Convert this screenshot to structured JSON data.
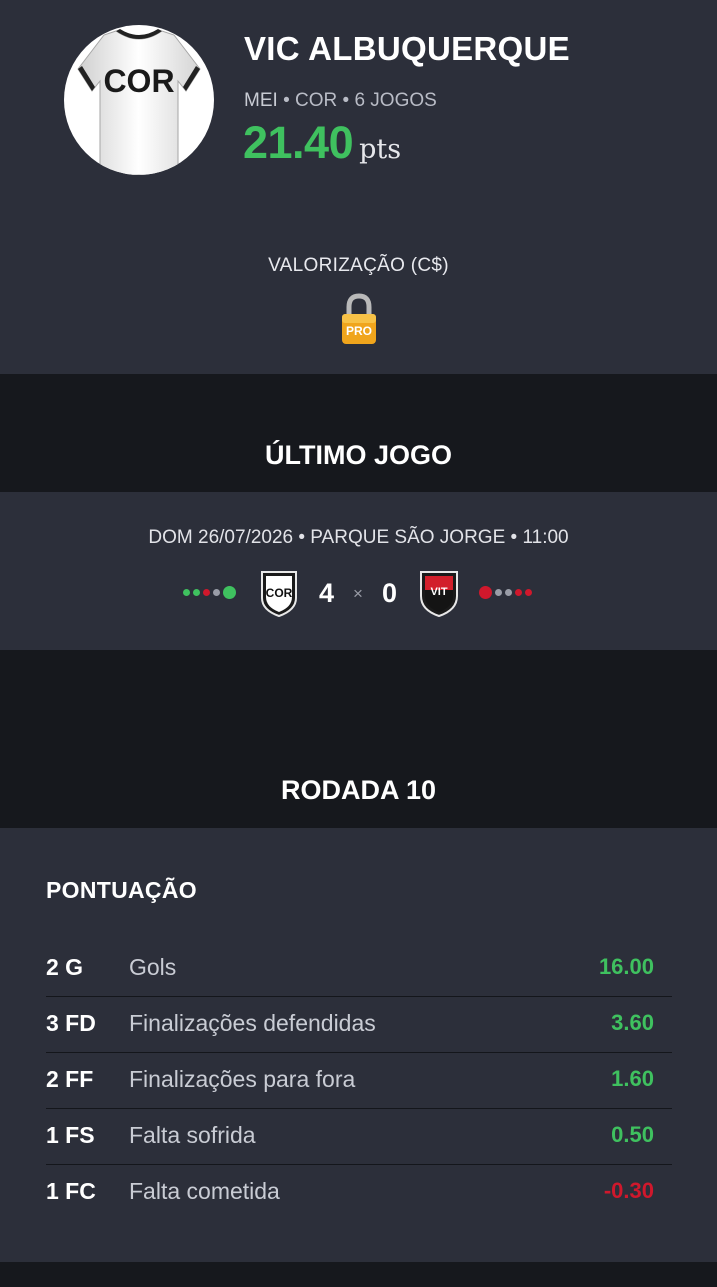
{
  "player": {
    "name": "VIC ALBUQUERQUE",
    "position": "MEI",
    "club": "COR",
    "games": "6 JOGOS",
    "separator": "•",
    "score": "21.40",
    "score_unit": "pts",
    "jersey_text": "COR"
  },
  "valorizacao": {
    "label": "VALORIZAÇÃO (C$)",
    "lock_text": "PRO"
  },
  "last_game": {
    "title": "ÚLTIMO JOGO",
    "info": "DOM 26/07/2026 • PARQUE SÃO JORGE • 11:00",
    "home_abbr": "COR",
    "away_abbr": "VIT",
    "home_goals": "4",
    "away_goals": "0",
    "times_symbol": "×",
    "home_form": [
      "win",
      "win",
      "loss",
      "draw",
      "win"
    ],
    "away_form": [
      "loss",
      "draw",
      "draw",
      "loss",
      "loss"
    ]
  },
  "rodada": {
    "title": "RODADA 10",
    "pontuacao_title": "PONTUAÇÃO",
    "stats": [
      {
        "code": "2 G",
        "label": "Gols",
        "value": "16.00",
        "sign": "positive"
      },
      {
        "code": "3 FD",
        "label": "Finalizações defendidas",
        "value": "3.60",
        "sign": "positive"
      },
      {
        "code": "2 FF",
        "label": "Finalizações para fora",
        "value": "1.60",
        "sign": "positive"
      },
      {
        "code": "1 FS",
        "label": "Falta sofrida",
        "value": "0.50",
        "sign": "positive"
      },
      {
        "code": "1 FC",
        "label": "Falta cometida",
        "value": "-0.30",
        "sign": "negative"
      }
    ]
  },
  "colors": {
    "positive": "#3fc15f",
    "negative": "#d0182c",
    "draw": "#9a9da7",
    "panel": "#2c2f3a",
    "background": "#16181d"
  },
  "icons": [
    "jersey-icon",
    "lock-icon",
    "corinthians-badge-icon",
    "vitoria-badge-icon"
  ]
}
